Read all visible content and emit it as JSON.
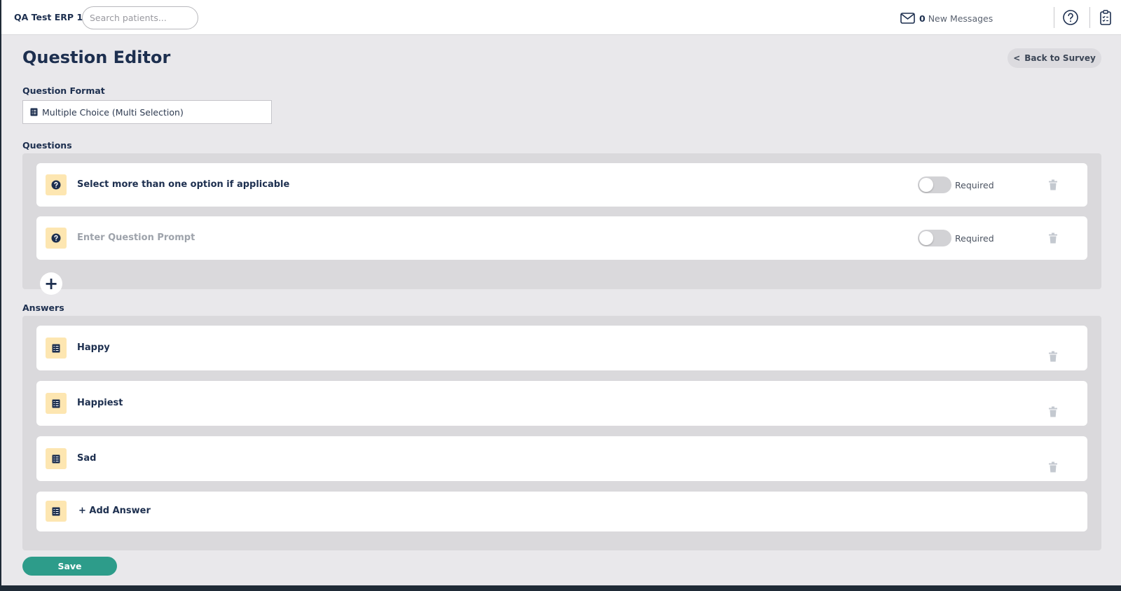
{
  "header": {
    "org_name": "QA Test ERP 1",
    "search_placeholder": "Search patients...",
    "messages_count": "0",
    "messages_label": "New Messages"
  },
  "page": {
    "title": "Question Editor",
    "back_label": "Back to Survey",
    "back_chevron": "<"
  },
  "format": {
    "label": "Question Format",
    "value": "Multiple Choice (Multi Selection)"
  },
  "questions": {
    "label": "Questions",
    "items": [
      {
        "text": "Select more than one option if applicable",
        "required_label": "Required",
        "required": false
      },
      {
        "placeholder": "Enter Question Prompt",
        "required_label": "Required",
        "required": false
      }
    ],
    "add_symbol": "+"
  },
  "answers": {
    "label": "Answers",
    "items": [
      {
        "text": "Happy"
      },
      {
        "text": "Happiest"
      },
      {
        "text": "Sad"
      }
    ],
    "add_label": "+ Add Answer"
  },
  "actions": {
    "save_label": "Save"
  },
  "colors": {
    "navy": "#1d2f4f",
    "badge": "#fde6b1",
    "save": "#2d9c8a",
    "page_bg": "#e9e8eb",
    "panel_bg": "#dad9dc"
  },
  "icons": {
    "messages": "envelope-icon",
    "help": "help-circle-icon",
    "clipboard": "clipboard-icon",
    "question": "question-icon",
    "list": "list-icon",
    "trash": "trash-icon"
  }
}
